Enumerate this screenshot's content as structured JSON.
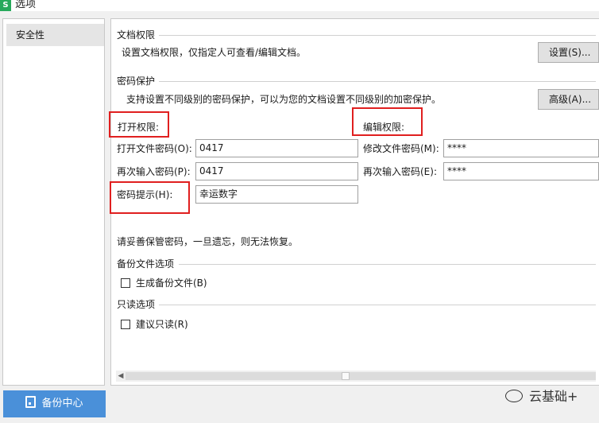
{
  "window": {
    "title": "选项",
    "app_icon_letter": "S"
  },
  "sidebar": {
    "items": [
      {
        "label": "安全性"
      }
    ],
    "backup_button": "备份中心"
  },
  "doc_permission": {
    "header": "文档权限",
    "description": "设置文档权限，仅指定人可查看/编辑文档。",
    "settings_button": "设置(S)..."
  },
  "password": {
    "header": "密码保护",
    "description": "支持设置不同级别的密码保护，可以为您的文档设置不同级别的加密保护。",
    "advanced_button": "高级(A)...",
    "open_permission_label": "打开权限:",
    "edit_permission_label": "编辑权限:",
    "open_password_label": "打开文件密码(O):",
    "open_password_value": "0417",
    "open_confirm_label": "再次输入密码(P):",
    "open_confirm_value": "0417",
    "hint_label": "密码提示(H):",
    "hint_value": "幸运数字",
    "modify_password_label": "修改文件密码(M):",
    "modify_password_value": "****",
    "modify_confirm_label": "再次输入密码(E):",
    "modify_confirm_value": "****",
    "warning": "请妥善保管密码，一旦遗忘，则无法恢复。"
  },
  "backup": {
    "header": "备份文件选项",
    "generate_backup_label": "生成备份文件(B)",
    "generate_backup_checked": false
  },
  "readonly": {
    "header": "只读选项",
    "suggest_readonly_label": "建议只读(R)",
    "suggest_readonly_checked": false
  },
  "watermark": {
    "text": "云基础+"
  },
  "colors": {
    "accent": "#4a90d9",
    "highlight": "#e01f1f",
    "app_icon": "#27a95b"
  }
}
